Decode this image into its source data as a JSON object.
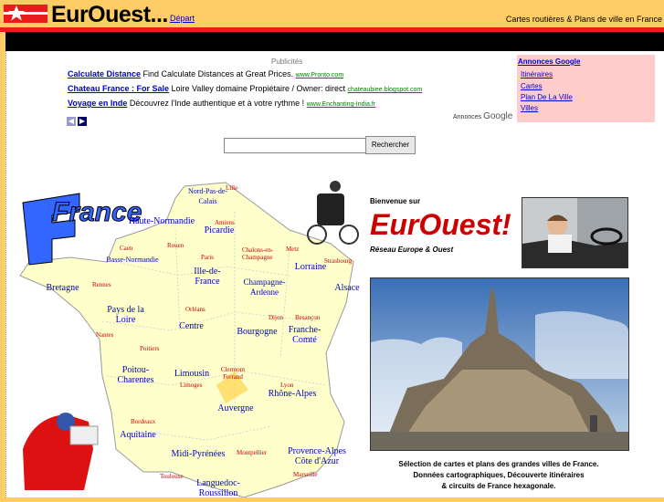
{
  "header": {
    "logo_text": "EurOuest...",
    "depart_link": "Départ",
    "tagline": "Cartes routières & Plans de ville en France"
  },
  "ads": {
    "heading": "Publicités",
    "items": [
      {
        "title": "Calculate Distance",
        "text": " Find Calculate Distances at Great Prices.",
        "url": "www.Pronto.com"
      },
      {
        "title": "Chateau France : For Sale",
        "text": " Loire Valley domaine Propiétaire / Owner: direct",
        "url": "chateaubiee.blogspot.com"
      },
      {
        "title": "Voyage en Inde",
        "text": " Découvrez l'Inde authentique et à votre rythme !",
        "url": "www.Enchanting-India.fr"
      }
    ],
    "ads_by": "Annonces",
    "google": "Google"
  },
  "google_box": {
    "heading": "Annonces Google",
    "links": [
      "Itinéraires",
      "Cartes",
      "Plan De La Ville",
      "Villes"
    ]
  },
  "search": {
    "button_label": "Rechercher",
    "value": ""
  },
  "map": {
    "title": "France",
    "regions": [
      "Nord-Pas-de-Calais",
      "Haute-Normandie",
      "Picardie",
      "Basse-Normandie",
      "Ille-de-France",
      "Champagne-Ardenne",
      "Lorraine",
      "Alsace",
      "Bretagne",
      "Pays de la Loire",
      "Centre",
      "Bourgogne",
      "Franche-Comté",
      "Poitou-Charentes",
      "Limousin",
      "Auvergne",
      "Rhône-Alpes",
      "Aquitaine",
      "Midi-Pyrénées",
      "Languedoc-Roussillon",
      "Provence-Alpes Côte d'Azur"
    ],
    "cities": [
      "Lille",
      "Amiens",
      "Rouen",
      "Caen",
      "Paris",
      "Chalons-en-Champagne",
      "Metz",
      "Strasbourg",
      "Rennes",
      "Nantes",
      "Orléans",
      "Dijon",
      "Besançon",
      "Poitiers",
      "Limoges",
      "Clermont Ferrand",
      "Lyon",
      "Bordeaux",
      "Toulouse",
      "Montpellier",
      "Marseille"
    ]
  },
  "intro": {
    "welcome": "Bienvenue sur",
    "brand": "EurOuest!",
    "subtitle": "Réseau Europe & Ouest",
    "description": [
      "Sélection de cartes et plans des grandes villes de France.",
      "Données cartographiques, Découverte itinéraires",
      "& circuits de France hexagonale."
    ]
  },
  "colors": {
    "header_bg": "#FFCC66",
    "accent_red": "#E81C1C",
    "link_blue": "#0000CC",
    "google_box": "#FFCCCC",
    "map_fill": "#FFFFCC"
  },
  "icons": [
    "star-logo-icon",
    "prev-arrow-icon",
    "next-arrow-icon"
  ]
}
